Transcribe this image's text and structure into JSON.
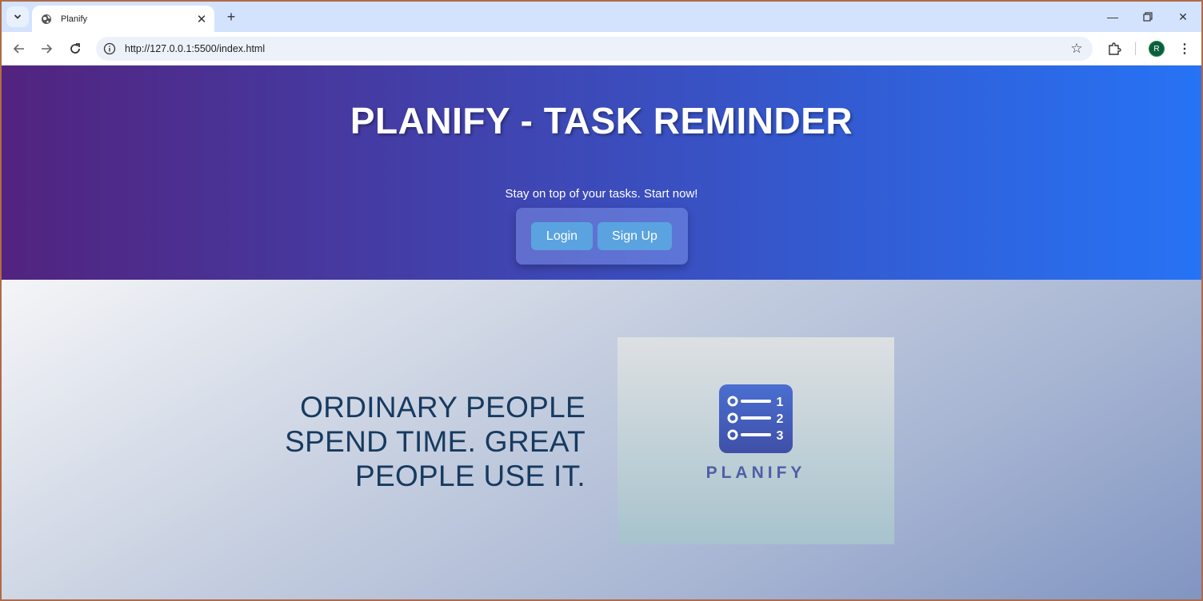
{
  "browser": {
    "tab": {
      "title": "Planify"
    },
    "address": {
      "url": "http://127.0.0.1:5500/index.html"
    },
    "profile_initial": "R"
  },
  "hero": {
    "title": "PLANIFY - TASK REMINDER",
    "subtitle": "Stay on top of your tasks. Start now!",
    "login_label": "Login",
    "signup_label": "Sign Up"
  },
  "content": {
    "quote_lines": [
      "ORDINARY PEOPLE",
      "SPEND TIME. GREAT",
      "PEOPLE USE IT."
    ],
    "logo": {
      "numbers": [
        "1",
        "2",
        "3"
      ],
      "wordmark": "PLANIFY"
    }
  },
  "colors": {
    "hero_gradient_start": "#52237f",
    "hero_gradient_end": "#2673f5",
    "button": "#5aa3e0",
    "quote_text": "#173a5f",
    "logo_text": "#4f5ea7"
  }
}
